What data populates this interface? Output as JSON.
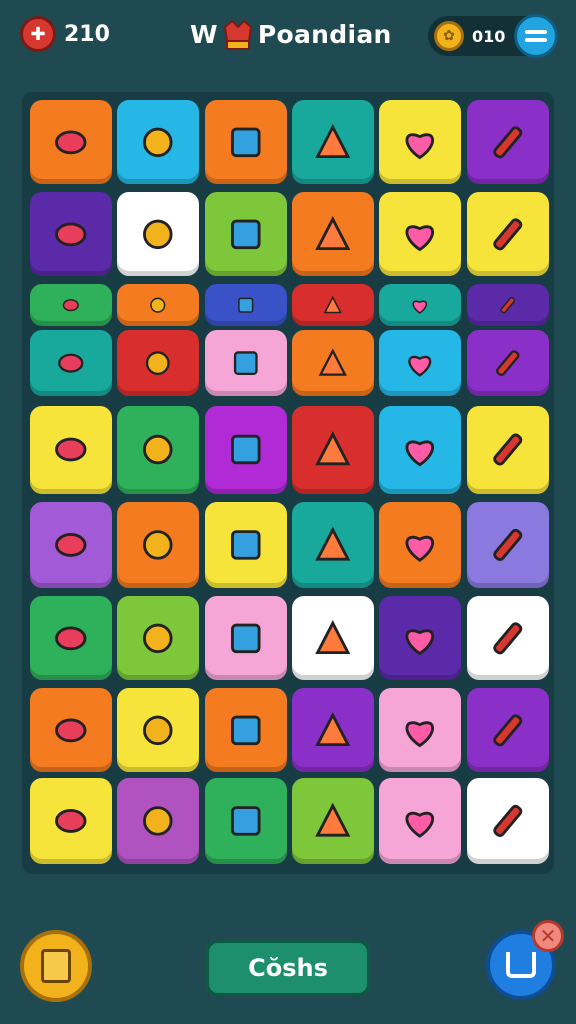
{
  "header": {
    "lives_count": "210",
    "title_prefix": "W",
    "title_rest": "Poandian",
    "coins_count": "010"
  },
  "footer": {
    "cta_label": "Cŏshs"
  },
  "colors": {
    "background": "#1f4a52",
    "board": "#173c44",
    "accent_green": "#1d8f6c",
    "accent_blue": "#1f7ee0",
    "coin_gold": "#f2b21c"
  },
  "grid": {
    "rows": 9,
    "columns": 6,
    "tiles": [
      {
        "color": "#f47b20",
        "icon": "leaf-icon"
      },
      {
        "color": "#25b8e6",
        "icon": "crown-icon"
      },
      {
        "color": "#f47b20",
        "icon": "tool-box-icon"
      },
      {
        "color": "#19a89c",
        "icon": "helmet-icon"
      },
      {
        "color": "#f7e43a",
        "icon": "cabbage-icon"
      },
      {
        "color": "#8b2fc9",
        "icon": "rose-icon"
      },
      {
        "color": "#5b2aa8",
        "icon": "bandage-icon"
      },
      {
        "color": "#ffffff",
        "icon": "book-icon"
      },
      {
        "color": "#7ec63a",
        "icon": "notepad-icon"
      },
      {
        "color": "#f47b20",
        "icon": "carton-icon"
      },
      {
        "color": "#f7e43a",
        "icon": "pencil-icon"
      },
      {
        "color": "#f7e43a",
        "icon": "flower-bouquet-icon"
      },
      {
        "color": "#2fb05a",
        "icon": "chest-icon"
      },
      {
        "color": "#f47b20",
        "icon": "hat-icon"
      },
      {
        "color": "#3a52c8",
        "icon": "boat-icon"
      },
      {
        "color": "#d92e2e",
        "icon": "submarine-icon"
      },
      {
        "color": "#19a89c",
        "icon": "cookie-icon"
      },
      {
        "color": "#5b2aa8",
        "icon": "bowl-icon"
      },
      {
        "color": "#19a89c",
        "icon": "candy-icon"
      },
      {
        "color": "#d92e2e",
        "icon": "swirl-icon"
      },
      {
        "color": "#f6a6d6",
        "icon": "smiley-icon"
      },
      {
        "color": "#f47b20",
        "icon": "apple-icon"
      },
      {
        "color": "#25b8e6",
        "icon": "cone-icon"
      },
      {
        "color": "#8b2fc9",
        "icon": "pot-icon"
      },
      {
        "color": "#f7e43a",
        "icon": "gear-icon"
      },
      {
        "color": "#2fb05a",
        "icon": "crayon-icon"
      },
      {
        "color": "#b02ad6",
        "icon": "heart-icon"
      },
      {
        "color": "#d92e2e",
        "icon": "wand-icon"
      },
      {
        "color": "#25b8e6",
        "icon": "brush-icon"
      },
      {
        "color": "#f7e43a",
        "icon": "chef-icon"
      },
      {
        "color": "#a25ad6",
        "icon": "badge-icon"
      },
      {
        "color": "#f47b20",
        "icon": "card-icon"
      },
      {
        "color": "#f7e43a",
        "icon": "trophy-icon"
      },
      {
        "color": "#19a89c",
        "icon": "frame-icon"
      },
      {
        "color": "#f47b20",
        "icon": "flowerpot-icon"
      },
      {
        "color": "#8a7ae0",
        "icon": "tube-icon"
      },
      {
        "color": "#2fb05a",
        "icon": "sponge-icon"
      },
      {
        "color": "#7ec63a",
        "icon": "cog-icon"
      },
      {
        "color": "#f6a6d6",
        "icon": "picture-icon"
      },
      {
        "color": "#ffffff",
        "icon": "ribbon-icon"
      },
      {
        "color": "#5b2aa8",
        "icon": "shield-icon"
      },
      {
        "color": "#ffffff",
        "icon": "melon-icon"
      },
      {
        "color": "#f47b20",
        "icon": "marker-icon"
      },
      {
        "color": "#f7e43a",
        "icon": "screwdriver-icon"
      },
      {
        "color": "#f47b20",
        "icon": "eraser-icon"
      },
      {
        "color": "#8b2fc9",
        "icon": "wrench-icon"
      },
      {
        "color": "#f6a6d6",
        "icon": "splat-icon"
      },
      {
        "color": "#8b2fc9",
        "icon": "sun-icon"
      },
      {
        "color": "#f7e43a",
        "icon": "popsicle-icon"
      },
      {
        "color": "#b052c0",
        "icon": "cherry-icon"
      },
      {
        "color": "#2fb05a",
        "icon": "cross-sticks-icon"
      },
      {
        "color": "#7ec63a",
        "icon": "crate-icon"
      },
      {
        "color": "#f6a6d6",
        "icon": "checkbox-icon"
      },
      {
        "color": "#ffffff",
        "icon": "sunflower-icon"
      }
    ]
  }
}
